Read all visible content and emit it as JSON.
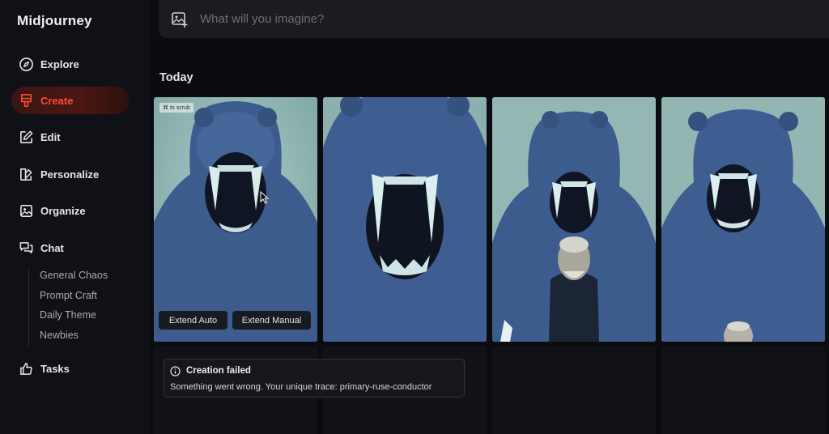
{
  "app": {
    "title": "Midjourney"
  },
  "sidebar": {
    "items": [
      {
        "label": "Explore",
        "icon": "compass-icon",
        "active": false
      },
      {
        "label": "Create",
        "icon": "brush-icon",
        "active": true
      },
      {
        "label": "Edit",
        "icon": "edit-icon",
        "active": false
      },
      {
        "label": "Personalize",
        "icon": "palette-icon",
        "active": false
      },
      {
        "label": "Organize",
        "icon": "image-icon",
        "active": false
      },
      {
        "label": "Chat",
        "icon": "chat-icon",
        "active": false
      },
      {
        "label": "Tasks",
        "icon": "thumbs-up-icon",
        "active": false
      }
    ],
    "chat_channels": [
      "General Chaos",
      "Prompt Craft",
      "Daily Theme",
      "Newbies"
    ]
  },
  "search": {
    "placeholder": "What will you imagine?",
    "value": ""
  },
  "section": {
    "title": "Today"
  },
  "grid": {
    "scrub_hint": "⌘ to scrub",
    "extend_auto": "Extend Auto",
    "extend_manual": "Extend Manual"
  },
  "toast": {
    "title": "Creation failed",
    "message": "Something went wrong. Your unique trace: primary-ruse-conductor"
  },
  "colors": {
    "accent": "#ff4a36",
    "background": "#0b0c10",
    "sidebar": "#101116",
    "image_tint": "#8fb3b1"
  }
}
